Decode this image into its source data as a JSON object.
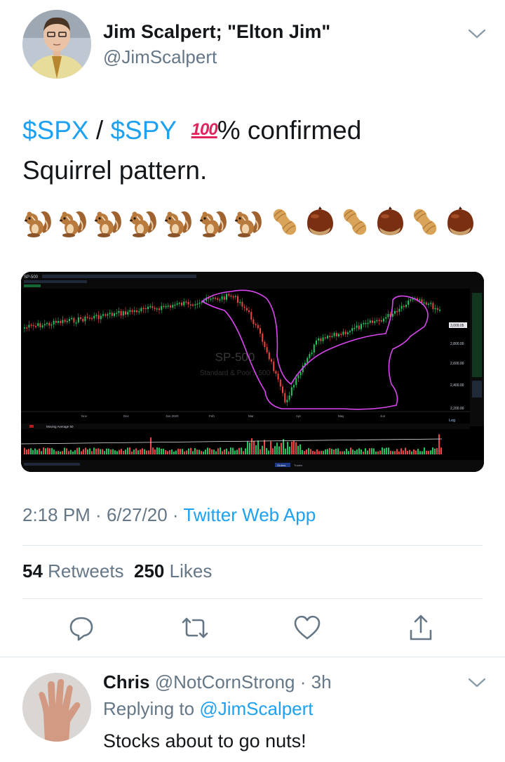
{
  "tweet": {
    "author_name": "Jim Scalpert; \"Elton Jim\"",
    "author_handle": "@JimScalpert",
    "text": {
      "cashtag_1": "$SPX",
      "sep": " / ",
      "cashtag_2": "$SPY",
      "hundred_emoji": "100",
      "line1_rest": "% confirmed",
      "line2": "Squirrel pattern."
    },
    "emojis": [
      "chipmunk-icon",
      "chipmunk-icon",
      "chipmunk-icon",
      "chipmunk-icon",
      "chipmunk-icon",
      "chipmunk-icon",
      "chipmunk-icon",
      "peanut-icon",
      "chestnut-icon",
      "peanut-icon",
      "chestnut-icon",
      "peanut-icon",
      "chestnut-icon"
    ],
    "time": "2:18 PM",
    "dot": " · ",
    "date": "6/27/20",
    "app": "Twitter Web App",
    "retweets_count": "54",
    "retweets_label": "Retweets",
    "likes_count": "250",
    "likes_label": "Likes",
    "actions": [
      "reply-icon",
      "retweet-icon",
      "like-icon",
      "share-icon"
    ]
  },
  "chart_image": {
    "symbol": "SP-500",
    "watermark_title": "SP-500",
    "watermark_subtitle": "Standard & Poor's 500",
    "price_labels": [
      "3,009.05",
      "2,800.00",
      "2,600.00",
      "2,400.00",
      "2,200.00"
    ],
    "scale_label": "Log",
    "month_labels": [
      "Nov",
      "Dec",
      "Jan 2020",
      "Feb",
      "Mar",
      "Apr",
      "May",
      "Jun"
    ],
    "indicator_label": "Moving Average 50",
    "bottom_tabs": [
      "Orders",
      "Trades"
    ],
    "colors": {
      "up": "#22c55e",
      "down": "#ef4444",
      "outline": "#d946ef",
      "price_tag": "#e5e7eb"
    }
  },
  "reply": {
    "author_name": "Chris",
    "author_handle": "@NotCornStrong",
    "dot": " · ",
    "age": "3h",
    "replying_prefix": "Replying to ",
    "replying_to": "@JimScalpert",
    "text": "Stocks about to go nuts!"
  },
  "colors": {
    "link": "#1da1f2",
    "secondary": "#657786",
    "primary": "#14171a",
    "divider": "#e1e8ed"
  }
}
